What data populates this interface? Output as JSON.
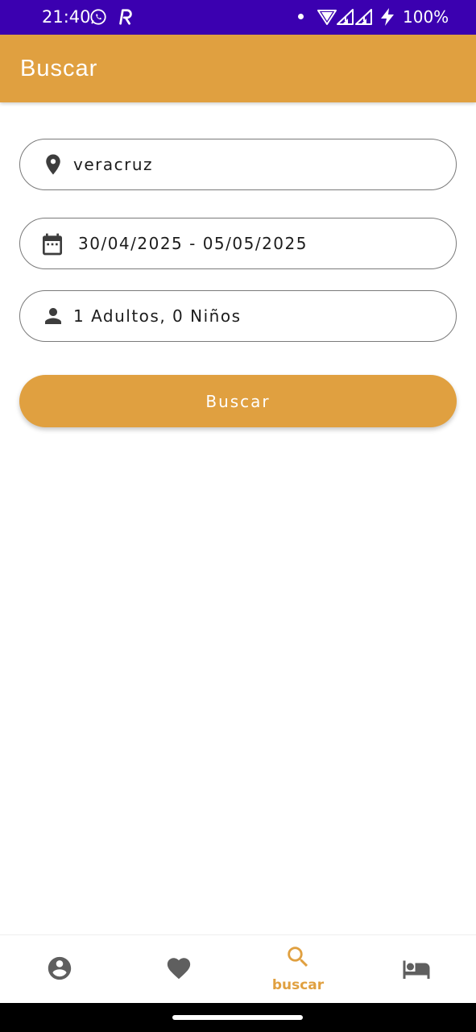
{
  "status_bar": {
    "time": "21:40",
    "battery": "100%",
    "app_icons": [
      "whatsapp-icon",
      "r-app-icon"
    ],
    "system_icons": [
      "dot",
      "wifi-icon",
      "signal-icon",
      "signal-icon",
      "charging-icon"
    ]
  },
  "app_bar": {
    "title": "Buscar"
  },
  "search_form": {
    "location": {
      "value": "veracruz",
      "icon": "location-pin-icon"
    },
    "dates": {
      "value": "30/04/2025 - 05/05/2025",
      "icon": "calendar-icon"
    },
    "guests": {
      "value": "1 Adultos, 0 Niños",
      "icon": "person-icon"
    },
    "submit_label": "Buscar"
  },
  "bottom_nav": {
    "items": [
      {
        "icon": "account-icon",
        "label": "",
        "active": false
      },
      {
        "icon": "heart-icon",
        "label": "",
        "active": false
      },
      {
        "icon": "search-icon",
        "label": "buscar",
        "active": true
      },
      {
        "icon": "bed-icon",
        "label": "",
        "active": false
      }
    ]
  },
  "colors": {
    "status_bar": "#3b00b0",
    "accent": "#e0a040",
    "icon_inactive": "#5f5f5f",
    "field_border": "#7a7a7a"
  }
}
